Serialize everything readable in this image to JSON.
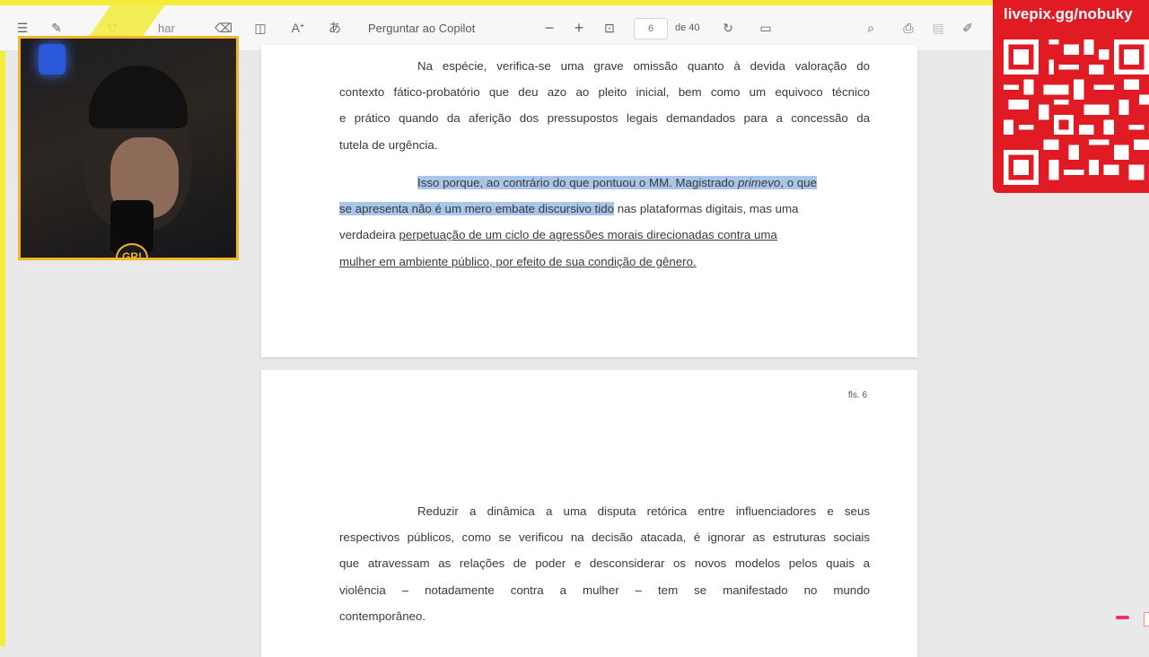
{
  "toolbar": {
    "ask_copilot_label": "Perguntar ao Copilot",
    "current_page": "6",
    "page_total_label": "de 40",
    "hidden_partial_label": "har"
  },
  "document": {
    "page1": {
      "paragraph1": {
        "lines": [
          "Na espécie, verifica-se uma grave omissão quanto à devida valoração do",
          "contexto fático-probatório que deu azo ao pleito inicial, bem como um equivoco técnico",
          "e prático quando da aferição dos pressupostos legais demandados para a concessão da",
          "tutela de urgência."
        ]
      },
      "paragraph2": {
        "line1_hl_a": "Isso porque, ao contrário do que pontuou o MM. Magistrado ",
        "line1_hl_italic": "primevo",
        "line1_hl_b": ", o que",
        "line2_hl": "se apresenta não é um mero embate discursivo tido",
        "line2_rest": " nas plataformas digitais, mas uma",
        "line3_plain": "verdadeira ",
        "line3_ul": "perpetuação de um ciclo de agressões morais direcionadas contra uma",
        "line4_ul": "mulher em ambiente público, por efeito de sua condição de gênero."
      }
    },
    "page2": {
      "folio": "fls. 6",
      "paragraph": {
        "lines": [
          "Reduzir a dinâmica a uma disputa retórica entre influenciadores e seus",
          "respectivos públicos, como se verificou na decisão atacada, é ignorar as estruturas sociais",
          "que atravessam as relações de poder e desconsiderar os novos modelos pelos quais a",
          "violência – notadamente contra a mulher – tem se manifestado no mundo",
          "contemporâneo."
        ]
      }
    }
  },
  "overlay": {
    "webcam_badge": "GR!",
    "livepix_url": "livepix.gg/nobuky"
  },
  "colors": {
    "frame": "#f3ec3a",
    "highlight": "#a9c6e8",
    "livepix_red": "#e01b24",
    "webcam_border": "#f1b52a"
  },
  "icons": [
    "menu-icon",
    "draw-icon",
    "filter-icon",
    "eraser-icon",
    "layout-icon",
    "read-aloud-icon",
    "translate-icon",
    "zoom-out-icon",
    "zoom-in-icon",
    "fit-page-icon",
    "rotate-icon",
    "page-view-icon",
    "search-icon",
    "print-icon",
    "save-icon",
    "edit-icon"
  ]
}
